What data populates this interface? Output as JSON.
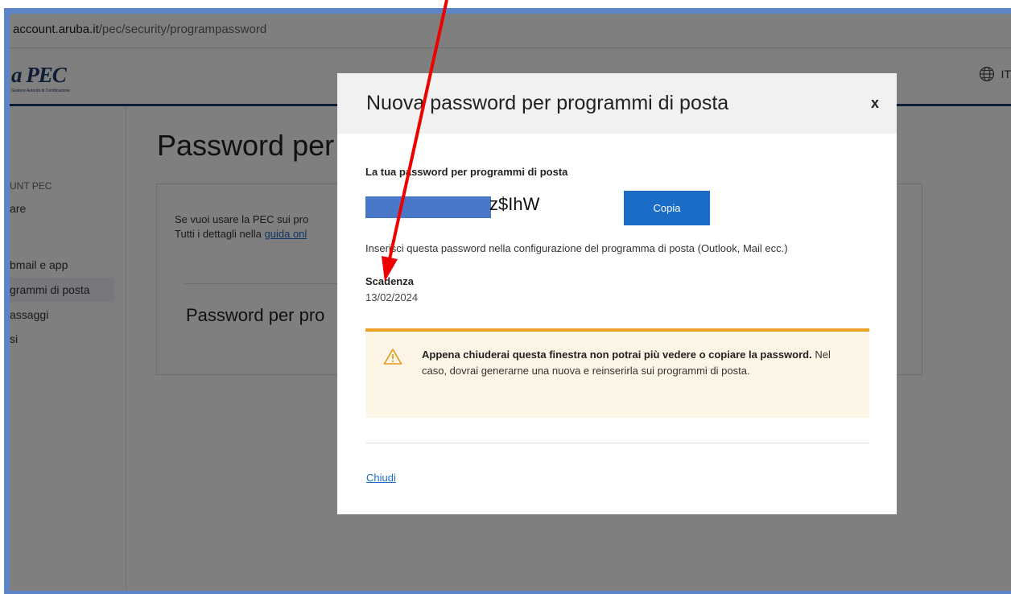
{
  "browser": {
    "url_host": "account.aruba.it",
    "url_path": "/pec/security/programpassword"
  },
  "header": {
    "logo_text": "a PEC",
    "logo_sub": "Gestore Autorità di Certificazione",
    "language": "IT"
  },
  "sidebar": {
    "section_label": "UNT PEC",
    "items": [
      {
        "label": "are"
      },
      {
        "label": "bmail e app"
      },
      {
        "label": "grammi di posta"
      },
      {
        "label": "assaggi"
      },
      {
        "label": "si"
      }
    ]
  },
  "main": {
    "title": "Password per",
    "line1": "Se vuoi usare la PEC sui pro",
    "line2_prefix": "Tutti i dettagli nella ",
    "line2_link": "guida onl",
    "subtitle": "Password per pro"
  },
  "modal": {
    "title": "Nuova password per programmi di posta",
    "close_label": "x",
    "password_label": "La tua password per programmi di posta",
    "password_visible": "z$IhW",
    "copy_label": "Copia",
    "hint": "Inserisci questa password nella configurazione del programma di posta (Outlook, Mail ecc.)",
    "expiry_label": "Scadenza",
    "expiry_value": "13/02/2024",
    "warning_bold": "Appena chiuderai questa finestra non potrai più vedere o copiare la password.",
    "warning_rest": " Nel caso, dovrai generarne una nuova e reinserirla sui programmi di posta.",
    "close_link": "Chiudi"
  },
  "colors": {
    "accent": "#1a6cc7",
    "frame": "#5b84c9",
    "warning_border": "#eda127",
    "warning_bg": "#fdf5e6",
    "annotation_arrow": "#ee0000"
  }
}
